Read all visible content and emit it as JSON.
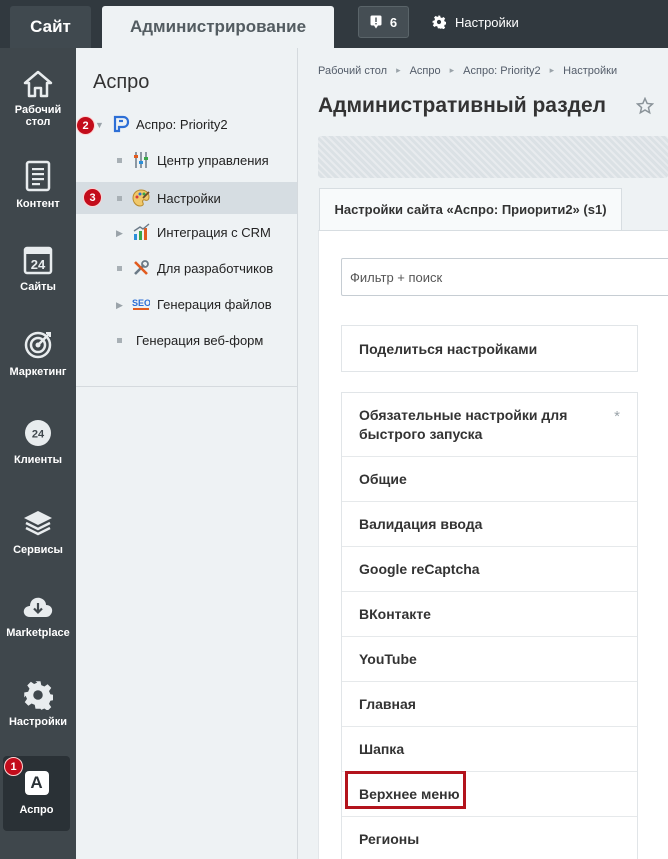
{
  "topbar": {
    "site_tab": "Сайт",
    "admin_tab": "Администрирование",
    "notifications_count": "6",
    "settings_label": "Настройки"
  },
  "left_menu": {
    "items": [
      {
        "label": "Рабочий стол",
        "icon": "home-icon"
      },
      {
        "label": "Контент",
        "icon": "document-icon"
      },
      {
        "label": "Сайты",
        "icon": "calendar-24-icon"
      },
      {
        "label": "Маркетинг",
        "icon": "target-icon"
      },
      {
        "label": "Клиенты",
        "icon": "clients-24-icon"
      },
      {
        "label": "Сервисы",
        "icon": "layers-icon"
      },
      {
        "label": "Marketplace",
        "icon": "cloud-download-icon"
      },
      {
        "label": "Настройки",
        "icon": "gear-icon"
      },
      {
        "label": "Аспро",
        "icon": "aspro-a-icon",
        "glyph": "A"
      }
    ]
  },
  "badges": {
    "one": "1",
    "two": "2",
    "three": "3"
  },
  "tree": {
    "title": "Аспро",
    "items": [
      {
        "label": "Аспро: Priority2"
      },
      {
        "label": "Центр управления"
      },
      {
        "label": "Настройки"
      },
      {
        "label": "Интеграция с CRM"
      },
      {
        "label": "Для разработчиков"
      },
      {
        "label": "Генерация файлов"
      },
      {
        "label": "Генерация веб-форм"
      }
    ]
  },
  "main": {
    "breadcrumb": [
      "Рабочий стол",
      "Аспро",
      "Аспро: Priority2",
      "Настройки"
    ],
    "title": "Административный раздел",
    "site_tab": "Настройки сайта «Аспро: Приорити2» (s1)",
    "filter_placeholder": "Фильтр + поиск",
    "share_label": "Поделиться настройками",
    "sections": [
      "Обязательные настройки для быстрого запуска",
      "Общие",
      "Валидация ввода",
      "Google reCaptcha",
      "ВКонтакте",
      "YouTube",
      "Главная",
      "Шапка",
      "Верхнее меню",
      "Регионы"
    ],
    "required_marker": "*"
  },
  "colors": {
    "topbar_bg": "#31393f",
    "left_menu_bg": "#3f474c",
    "highlight_red": "#b3131c",
    "badge_red": "#c30c1b"
  }
}
